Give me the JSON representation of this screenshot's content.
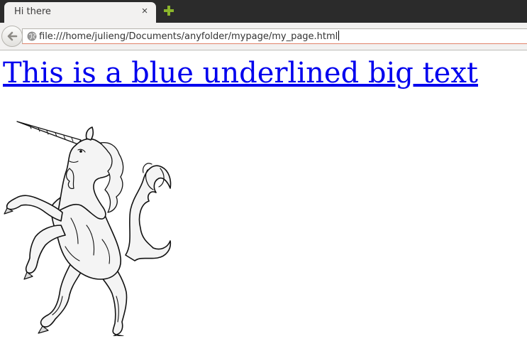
{
  "browser": {
    "tab": {
      "title": "Hi there",
      "close_glyph": "×"
    },
    "new_tab_icon": "plus-icon",
    "back_icon": "arrow-left-icon",
    "site_icon": "globe-icon",
    "url": "file:///home/julieng/Documents/anyfolder/mypage/my_page.html",
    "colors": {
      "tabstrip": "#2b2b2b",
      "new_tab": "#8bb52b",
      "url_focus_border": "#e0826a"
    }
  },
  "page": {
    "heading_link": "This is a blue underlined big text",
    "link_color": "#0000ee",
    "image": "unicorn-rampant-illustration"
  }
}
